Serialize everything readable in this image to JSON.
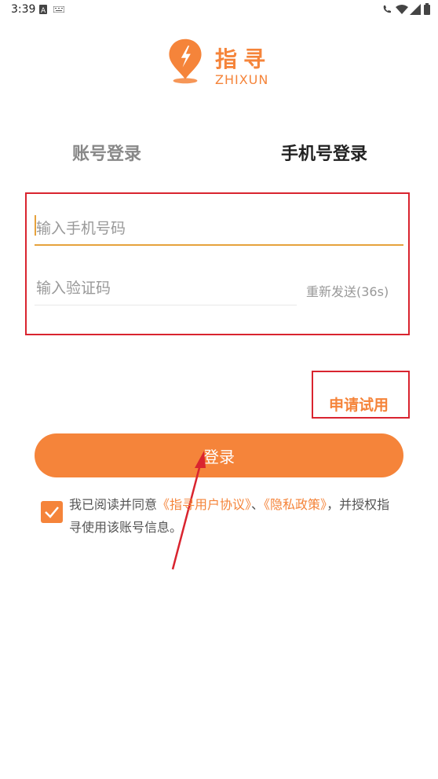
{
  "status_bar": {
    "time": "3:39"
  },
  "logo": {
    "title": "指寻",
    "subtitle": "ZHIXUN",
    "icon": "location-pin-lightning-icon"
  },
  "tabs": {
    "account": "账号登录",
    "phone": "手机号登录"
  },
  "form": {
    "phone_placeholder": "输入手机号码",
    "code_placeholder": "输入验证码",
    "resend_label": "重新发送(36s)"
  },
  "trial_label": "申请试用",
  "login_button": "登录",
  "agreement": {
    "prefix": "我已阅读并同意",
    "user_agreement": "《指寻用户协议》",
    "separator": "、",
    "privacy_policy": "《隐私政策》",
    "suffix": "，并授权指寻使用该账号信息。"
  },
  "colors": {
    "accent": "#f5843a",
    "annotation_red": "#d9242f",
    "input_underline": "#e6a23c"
  }
}
